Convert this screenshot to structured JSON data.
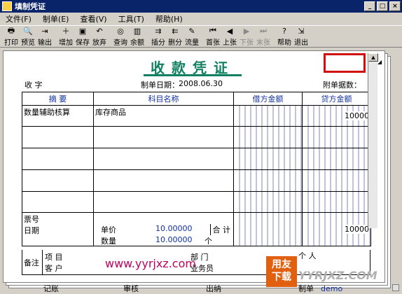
{
  "window": {
    "title": "填制凭证",
    "min": "_",
    "max": "□",
    "close": "×"
  },
  "menu": [
    "文件(F)",
    "制单(E)",
    "查看(V)",
    "工具(T)",
    "帮助(H)"
  ],
  "toolbar": [
    {
      "label": "打印",
      "icon": "printer-icon",
      "glyph": "🖶",
      "enabled": true
    },
    {
      "label": "预览",
      "icon": "preview-icon",
      "glyph": "🔍",
      "enabled": true
    },
    {
      "label": "输出",
      "icon": "export-icon",
      "glyph": "⇥",
      "enabled": true
    },
    {
      "label": "增加",
      "icon": "add-icon",
      "glyph": "＋",
      "enabled": true
    },
    {
      "label": "保存",
      "icon": "save-icon",
      "glyph": "▣",
      "enabled": true
    },
    {
      "label": "放弃",
      "icon": "undo-icon",
      "glyph": "↶",
      "enabled": true
    },
    {
      "label": "查询",
      "icon": "binoculars-icon",
      "glyph": "◎",
      "enabled": true
    },
    {
      "label": "余额",
      "icon": "balance-chart-icon",
      "glyph": "▥",
      "enabled": true
    },
    {
      "label": "插分",
      "icon": "insert-row-icon",
      "glyph": "⇉",
      "enabled": true
    },
    {
      "label": "删分",
      "icon": "delete-row-icon",
      "glyph": "⇇",
      "enabled": true
    },
    {
      "label": "流量",
      "icon": "flow-icon",
      "glyph": "✎",
      "enabled": true
    },
    {
      "label": "首张",
      "icon": "first-icon",
      "glyph": "⏮",
      "enabled": true
    },
    {
      "label": "上张",
      "icon": "prev-icon",
      "glyph": "◀",
      "enabled": true
    },
    {
      "label": "下张",
      "icon": "next-icon",
      "glyph": "▶",
      "enabled": false
    },
    {
      "label": "末张",
      "icon": "last-icon",
      "glyph": "⏭",
      "enabled": false
    },
    {
      "label": "帮助",
      "icon": "help-icon",
      "glyph": "?",
      "enabled": true
    },
    {
      "label": "退出",
      "icon": "exit-icon",
      "glyph": "⇲",
      "enabled": true
    }
  ],
  "voucher": {
    "title": "收款凭证",
    "type_label": "收  字",
    "date_label": "制单日期：",
    "date": "2008.06.30",
    "attach_label": "附单据数：",
    "headers": {
      "summary": "摘  要",
      "account": "科目名称",
      "debit": "借方金额",
      "credit": "贷方金额"
    },
    "rows": [
      {
        "summary": "数量辅助核算",
        "account": "库存商品",
        "debit": "",
        "credit": "10000"
      },
      {
        "summary": "",
        "account": "",
        "debit": "",
        "credit": ""
      },
      {
        "summary": "",
        "account": "",
        "debit": "",
        "credit": ""
      },
      {
        "summary": "",
        "account": "",
        "debit": "",
        "credit": ""
      },
      {
        "summary": "",
        "account": "",
        "debit": "",
        "credit": ""
      }
    ],
    "ticket_label": "票号",
    "date2_label": "日期",
    "unit_price_label": "单价",
    "unit_price": "10.00000",
    "qty_label": "数量",
    "qty": "10.00000",
    "qty_unit": "个",
    "total_label": "合 计",
    "total_credit": "10000",
    "remark_label": "备注",
    "project_label": "项  目",
    "customer_label": "客  户",
    "dept_label": "部  门",
    "person_label": "个  人",
    "business_label": "业务员"
  },
  "watermark": {
    "url": "www.yyrjxz.com",
    "logo_top": "用友",
    "logo_bottom": "下载",
    "logo_side": "YYRJXZ.COM"
  },
  "status": {
    "book": "记账",
    "audit": "审核",
    "cashier": "出纳",
    "maker": "制单",
    "maker_name": "demo"
  },
  "colors": {
    "title_green": "#108060",
    "highlight_red": "#d01010",
    "header_blue": "#1030a0"
  }
}
